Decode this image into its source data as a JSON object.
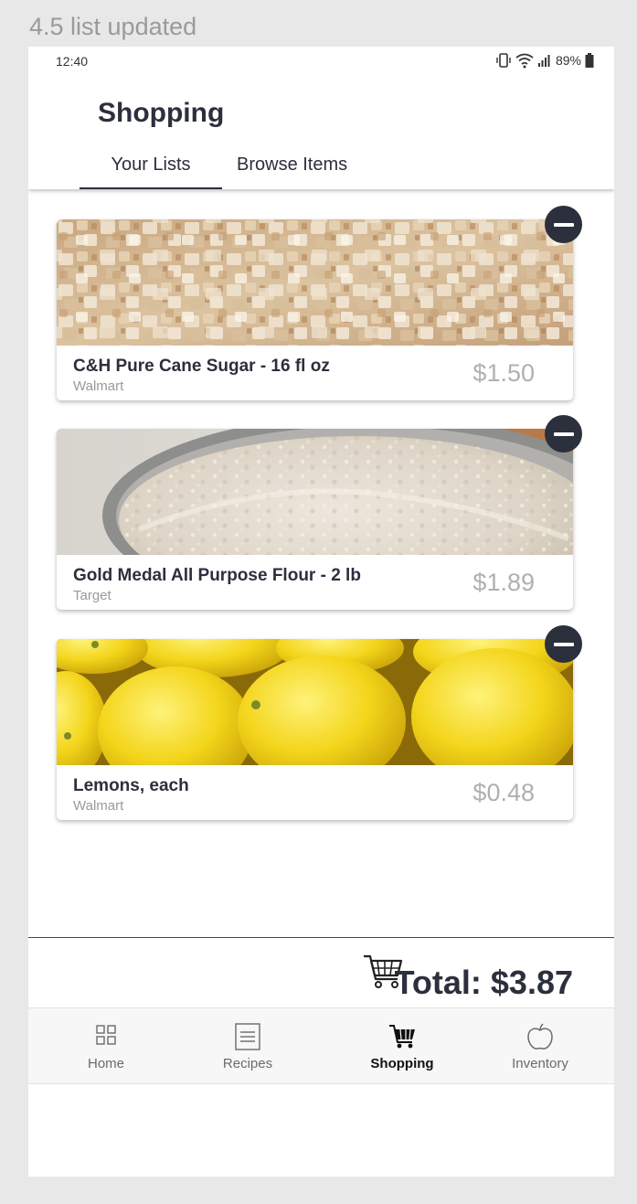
{
  "frame_label": "4.5 list updated",
  "status_bar": {
    "time": "12:40",
    "battery": "89%"
  },
  "app": {
    "title": "Shopping"
  },
  "tabs": [
    {
      "label": "Your Lists",
      "active": true
    },
    {
      "label": "Browse Items",
      "active": false
    }
  ],
  "items": [
    {
      "name": "C&H Pure Cane Sugar - 16 fl oz",
      "store": "Walmart",
      "price": "$1.50",
      "image": "sugar-crystals"
    },
    {
      "name": "Gold Medal All Purpose Flour - 2 lb",
      "store": "Target",
      "price": "$1.89",
      "image": "flour-bowl"
    },
    {
      "name": "Lemons, each",
      "store": "Walmart",
      "price": "$0.48",
      "image": "lemons"
    }
  ],
  "total": {
    "label": "Total: $3.87"
  },
  "nav": [
    {
      "label": "Home",
      "icon": "grid-icon"
    },
    {
      "label": "Recipes",
      "icon": "recipe-list-icon"
    },
    {
      "label": "Shopping",
      "icon": "cart-icon",
      "active": true
    },
    {
      "label": "Inventory",
      "icon": "apple-icon"
    }
  ],
  "colors": {
    "accent": "#2c2f3c",
    "muted": "#9a9a9a"
  }
}
